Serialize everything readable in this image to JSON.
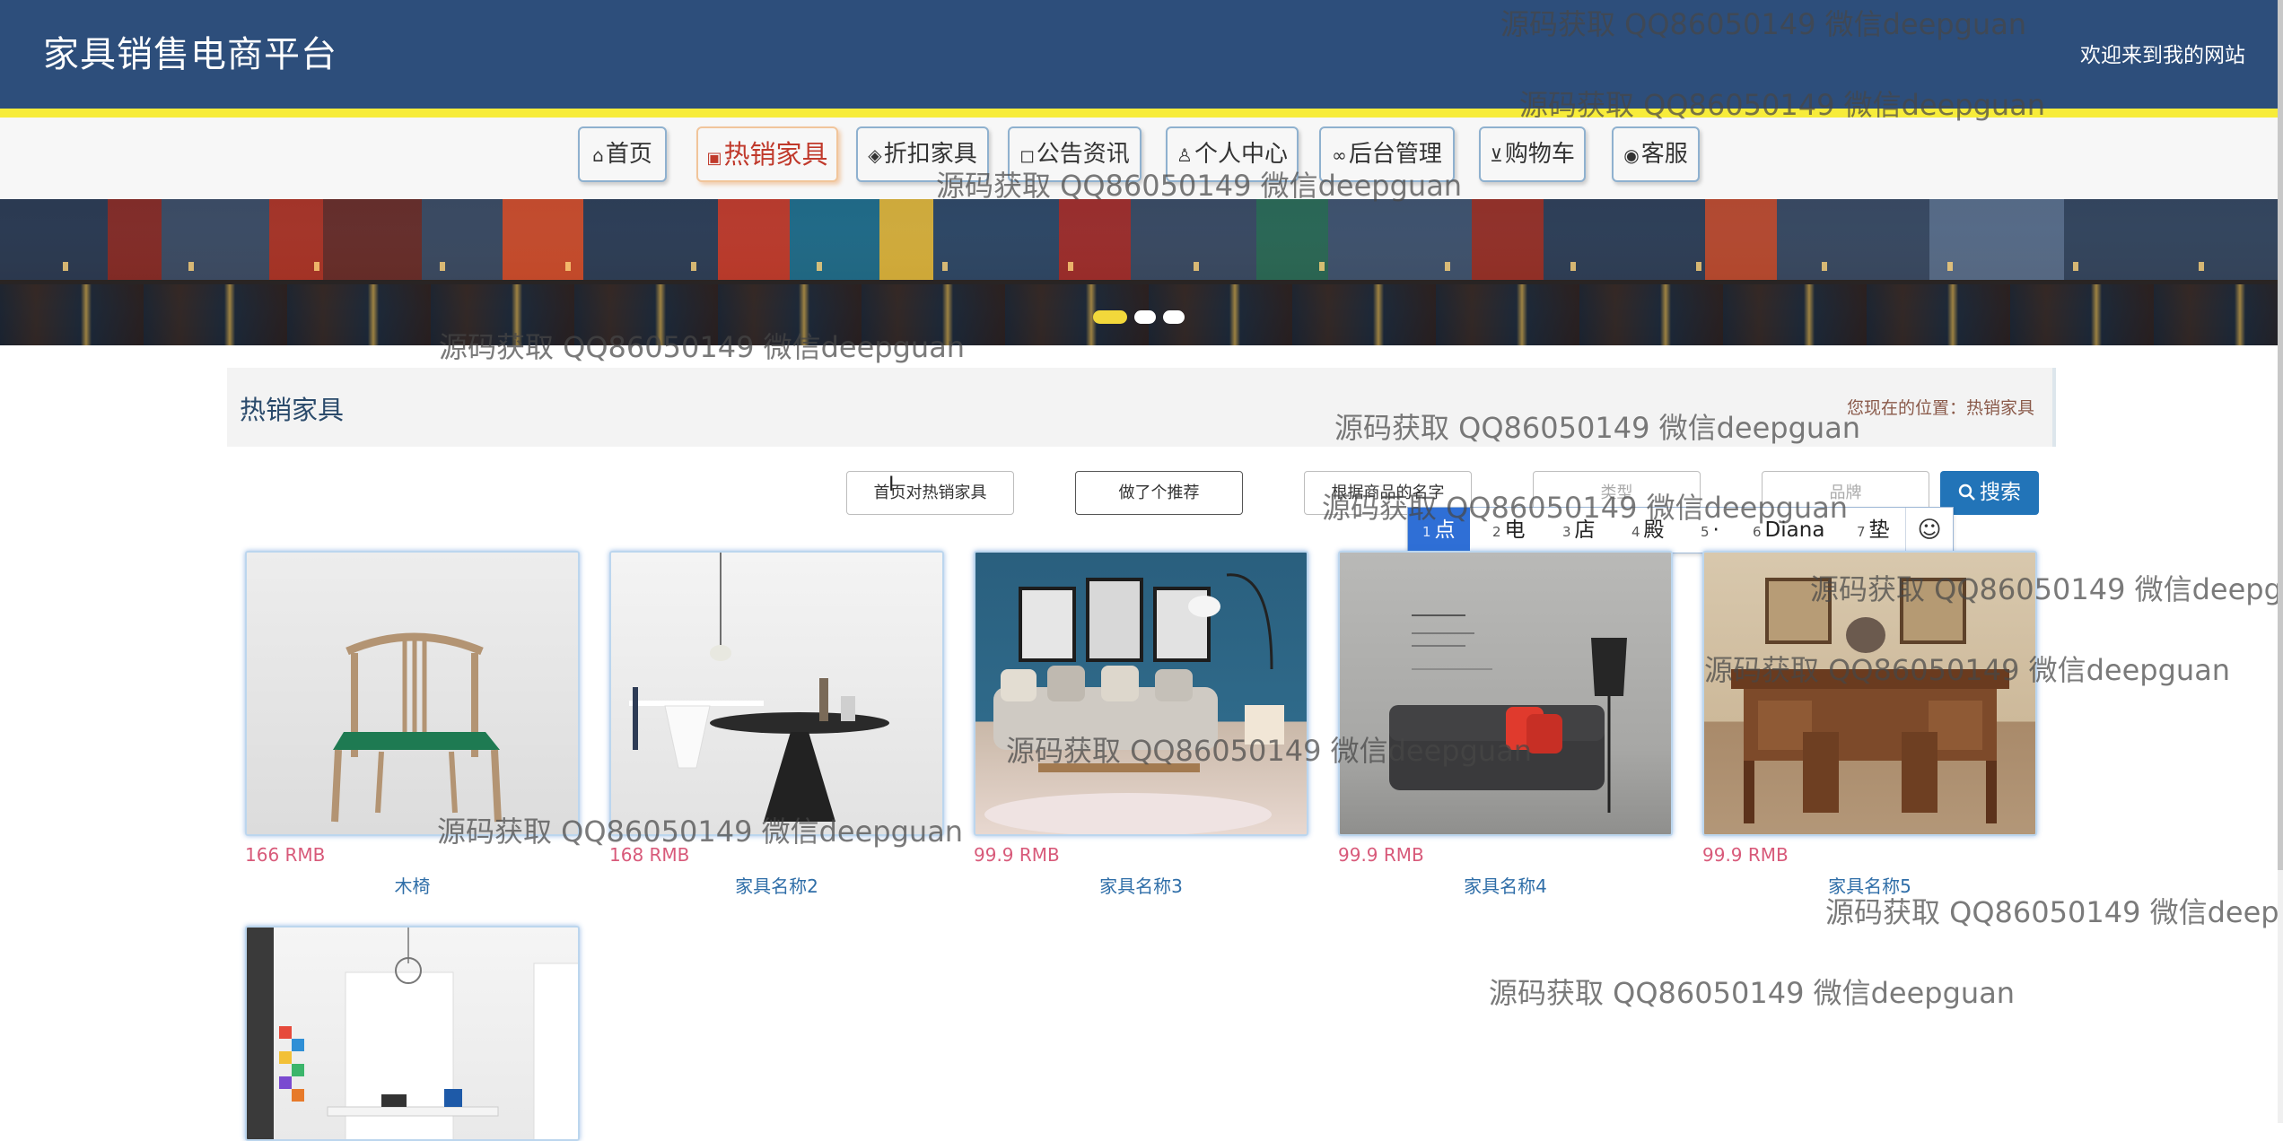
{
  "header": {
    "site_title": "家具销售电商平台",
    "welcome": "欢迎来到我的网站",
    "background_color": "#2d4e7b",
    "accent_color": "#f7ec3a"
  },
  "nav": {
    "items": [
      {
        "label": "首页",
        "icon": "home-icon"
      },
      {
        "label": "热销家具",
        "icon": "gift-icon",
        "active": true
      },
      {
        "label": "折扣家具",
        "icon": "layers-icon"
      },
      {
        "label": "公告资讯",
        "icon": "note-icon"
      },
      {
        "label": "个人中心",
        "icon": "user-icon"
      },
      {
        "label": "后台管理",
        "icon": "link-icon"
      },
      {
        "label": "购物车",
        "icon": "cart-icon"
      },
      {
        "label": "客服",
        "icon": "support-icon"
      }
    ]
  },
  "banner": {
    "slides": 3,
    "active_slide": 1
  },
  "section": {
    "title": "热销家具",
    "breadcrumb": "您现在的位置：热销家具"
  },
  "filters": {
    "btn_hot_home": "首页对热销家具",
    "btn_recommend": "做了个推荐",
    "field_product_name": "根据商品的名字",
    "type_placeholder": "类型",
    "brand_placeholder": "品牌",
    "search_label": "搜索"
  },
  "ime": {
    "candidates": [
      {
        "n": "1",
        "text": "点"
      },
      {
        "n": "2",
        "text": "电"
      },
      {
        "n": "3",
        "text": "店"
      },
      {
        "n": "4",
        "text": "殿"
      },
      {
        "n": "5",
        "text": "·"
      },
      {
        "n": "6",
        "text": "Diana"
      },
      {
        "n": "7",
        "text": "垫"
      }
    ],
    "emoji": "☺"
  },
  "products": [
    {
      "price": "166 RMB",
      "name": "木椅"
    },
    {
      "price": "168 RMB",
      "name": "家具名称2"
    },
    {
      "price": "99.9 RMB",
      "name": "家具名称3"
    },
    {
      "price": "99.9 RMB",
      "name": "家具名称4"
    },
    {
      "price": "99.9 RMB",
      "name": "家具名称5"
    },
    {
      "price": "",
      "name": ""
    }
  ],
  "watermark": "源码获取 QQ86050149 微信deepguan"
}
